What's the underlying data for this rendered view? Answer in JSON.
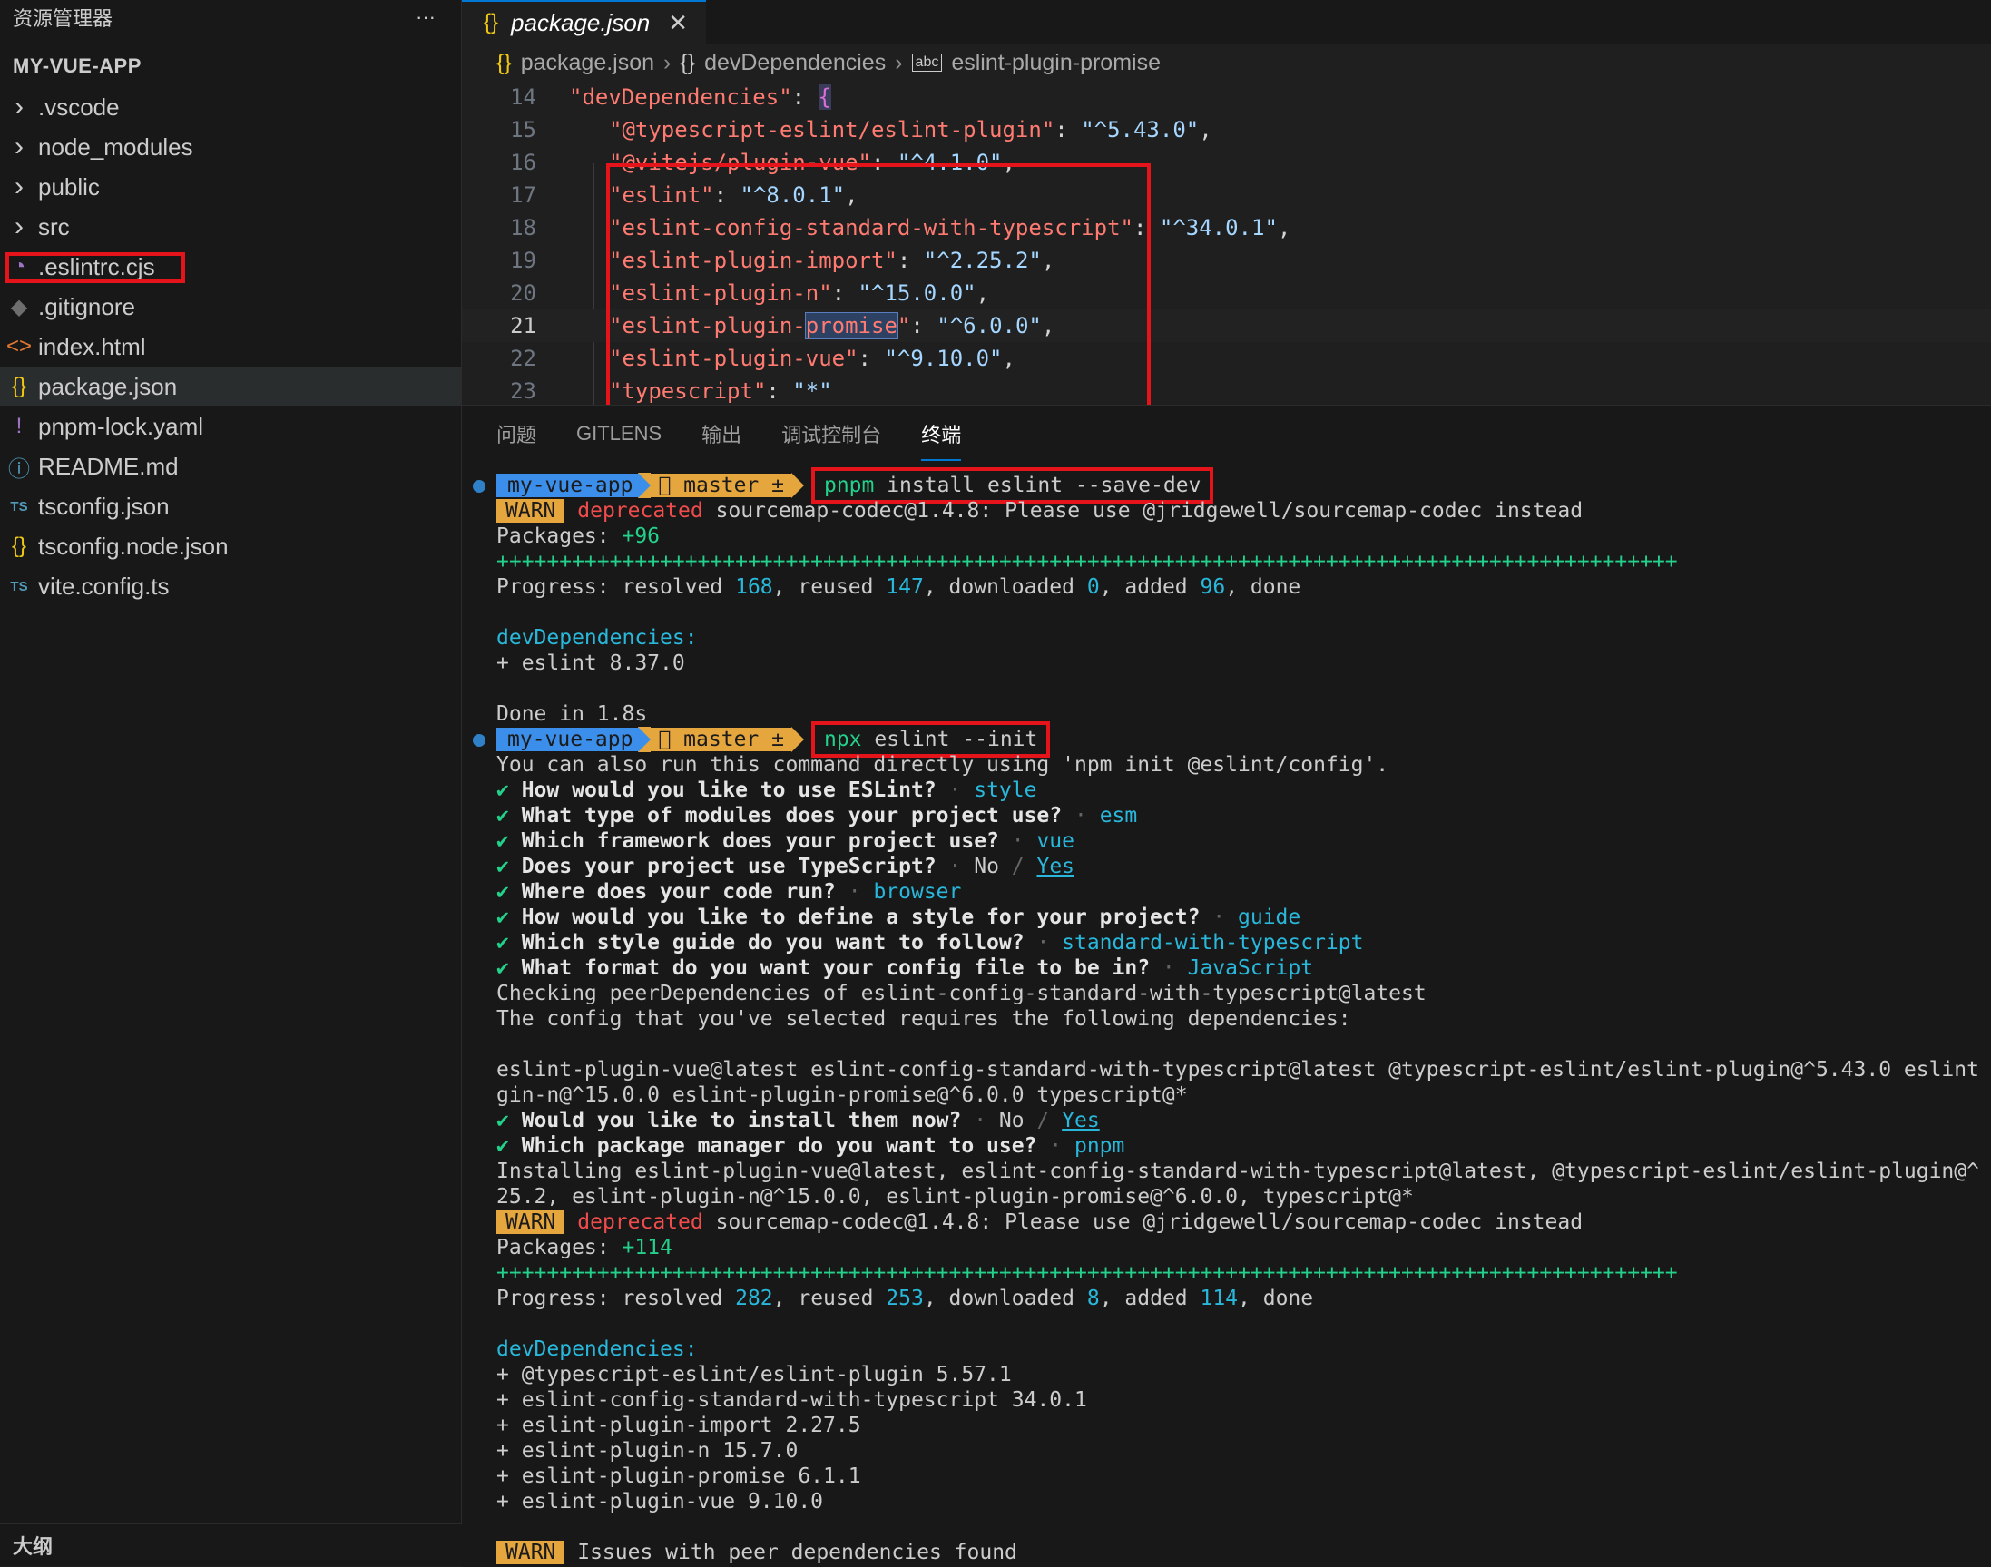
{
  "sidebar": {
    "title": "资源管理器",
    "more_label": "···",
    "project": "MY-VUE-APP",
    "outline": "大纲",
    "items": [
      {
        "label": ".vscode",
        "icon": "chevron-right-icon",
        "glyph": "›"
      },
      {
        "label": "node_modules",
        "icon": "chevron-right-icon",
        "glyph": "›"
      },
      {
        "label": "public",
        "icon": "chevron-right-icon",
        "glyph": "›"
      },
      {
        "label": "src",
        "icon": "chevron-right-icon",
        "glyph": "›"
      },
      {
        "label": ".eslintrc.cjs",
        "icon": "eslint-icon",
        "glyph": "◔"
      },
      {
        "label": ".gitignore",
        "icon": "git-icon",
        "glyph": "◆"
      },
      {
        "label": "index.html",
        "icon": "html-icon",
        "glyph": "<>"
      },
      {
        "label": "package.json",
        "icon": "json-braces-icon",
        "glyph": "{}"
      },
      {
        "label": "pnpm-lock.yaml",
        "icon": "yaml-exclamation-icon",
        "glyph": "!"
      },
      {
        "label": "README.md",
        "icon": "info-icon",
        "glyph": "ⓘ"
      },
      {
        "label": "tsconfig.json",
        "icon": "ts-config-icon",
        "glyph": "TS"
      },
      {
        "label": "tsconfig.node.json",
        "icon": "json-braces-icon",
        "glyph": "{}"
      },
      {
        "label": "vite.config.ts",
        "icon": "typescript-icon",
        "glyph": "TS"
      }
    ]
  },
  "editor": {
    "tab": {
      "icon": "{}",
      "label": "package.json",
      "close": "✕"
    },
    "breadcrumb": [
      "package.json",
      "devDependencies",
      "eslint-plugin-promise"
    ],
    "breadcrumb_sep": "›",
    "lines": [
      {
        "n": "14",
        "key": "devDependencies",
        "val": ""
      },
      {
        "n": "15",
        "key": "@typescript-eslint/eslint-plugin",
        "val": "^5.43.0"
      },
      {
        "n": "16",
        "key": "@vitejs/plugin-vue",
        "val": "^4.1.0"
      },
      {
        "n": "17",
        "key": "eslint",
        "val": "^8.0.1"
      },
      {
        "n": "18",
        "key": "eslint-config-standard-with-typescript",
        "val": "^34.0.1"
      },
      {
        "n": "19",
        "key": "eslint-plugin-import",
        "val": "^2.25.2"
      },
      {
        "n": "20",
        "key": "eslint-plugin-n",
        "val": "^15.0.0"
      },
      {
        "n": "21",
        "key": "eslint-plugin-promise",
        "val": "^6.0.0"
      },
      {
        "n": "22",
        "key": "eslint-plugin-vue",
        "val": "^9.10.0"
      },
      {
        "n": "23",
        "key": "typescript",
        "val": "*"
      }
    ]
  },
  "panel": {
    "tabs": [
      "问题",
      "GITLENS",
      "输出",
      "调试控制台",
      "终端"
    ],
    "active_tab": "终端"
  },
  "terminal": {
    "prompt_dir": "my-vue-app",
    "prompt_branch": " master ±",
    "cmd1_bin": "pnpm",
    "cmd1_args": " install eslint --save-dev",
    "warn": "WARN",
    "deprecated": "deprecated",
    "deprecated_msg": " sourcemap-codec@1.4.8: Please use @jridgewell/sourcemap-codec instead",
    "packages1_label": "Packages: ",
    "packages1_val": "+96",
    "progress_bar": "++++++++++++++++++++++++++++++++++++++++++++++++++++++++++++++++++++++++++++++++++++++++++++++",
    "p1": {
      "resolved": "168",
      "reused": "147",
      "downloaded": "0",
      "added": "96"
    },
    "devdeps_label": "devDependencies:",
    "dev1": "+ eslint 8.37.0",
    "done": "Done in 1.8s",
    "cmd2_bin": "npx",
    "cmd2_args": " eslint --init",
    "also_run": "You can also run this command directly using 'npm init @eslint/config'.",
    "qa": [
      {
        "q": "How would you like to use ESLint?",
        "a": "style"
      },
      {
        "q": "What type of modules does your project use?",
        "a": "esm"
      },
      {
        "q": "Which framework does your project use?",
        "a": "vue"
      },
      {
        "q": "Where does your code run?",
        "a": "browser"
      },
      {
        "q": "How would you like to define a style for your project?",
        "a": "guide"
      },
      {
        "q": "Which style guide do you want to follow?",
        "a": "standard-with-typescript"
      },
      {
        "q": "What format do you want your config file to be in?",
        "a": "JavaScript"
      }
    ],
    "ts_q": "Does your project use TypeScript?",
    "no_label": "No",
    "slash": "/",
    "yes_label": "Yes",
    "checking": "Checking peerDependencies of eslint-config-standard-with-typescript@latest",
    "requires": "The config that you've selected requires the following dependencies:",
    "deps_line1": "eslint-plugin-vue@latest eslint-config-standard-with-typescript@latest @typescript-eslint/eslint-plugin@^5.43.0 eslint",
    "deps_line2": "gin-n@^15.0.0 eslint-plugin-promise@^6.0.0 typescript@*",
    "install_q": "Would you like to install them now?",
    "pm_q": "Which package manager do you want to use?",
    "pm_a": "pnpm",
    "installing1": "Installing eslint-plugin-vue@latest, eslint-config-standard-with-typescript@latest, @typescript-eslint/eslint-plugin@^",
    "installing2": "25.2, eslint-plugin-n@^15.0.0, eslint-plugin-promise@^6.0.0, typescript@*",
    "packages2_val": "+114",
    "p2": {
      "resolved": "282",
      "reused": "253",
      "downloaded": "8",
      "added": "114"
    },
    "dev2": [
      "+ @typescript-eslint/eslint-plugin 5.57.1",
      "+ eslint-config-standard-with-typescript 34.0.1",
      "+ eslint-plugin-import 2.27.5",
      "+ eslint-plugin-n 15.7.0",
      "+ eslint-plugin-promise 6.1.1",
      "+ eslint-plugin-vue 9.10.0"
    ],
    "peer_warn": "Issues with peer dependencies found"
  },
  "colors": {
    "highlight_box": "#e5141b",
    "accent": "#0078d4"
  }
}
